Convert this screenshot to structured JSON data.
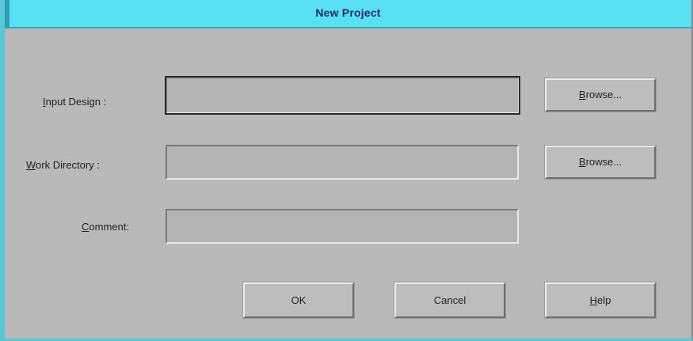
{
  "window": {
    "title": "New Project"
  },
  "form": {
    "input_design": {
      "label_mnemonic": "I",
      "label_rest": "nput Design :",
      "value": ""
    },
    "work_directory": {
      "label_mnemonic": "W",
      "label_rest": "ork Directory :",
      "value": ""
    },
    "comment": {
      "label_mnemonic": "C",
      "label_rest": "omment:",
      "value": ""
    }
  },
  "buttons": {
    "browse_mnemonic": "B",
    "browse_rest": "rowse...",
    "ok": "OK",
    "cancel": "Cancel",
    "help_mnemonic": "H",
    "help_rest": "elp"
  },
  "colors": {
    "titlebar": "#57e1f3",
    "title_text": "#1d2a6e",
    "dialog_bg": "#b9b9b9"
  }
}
